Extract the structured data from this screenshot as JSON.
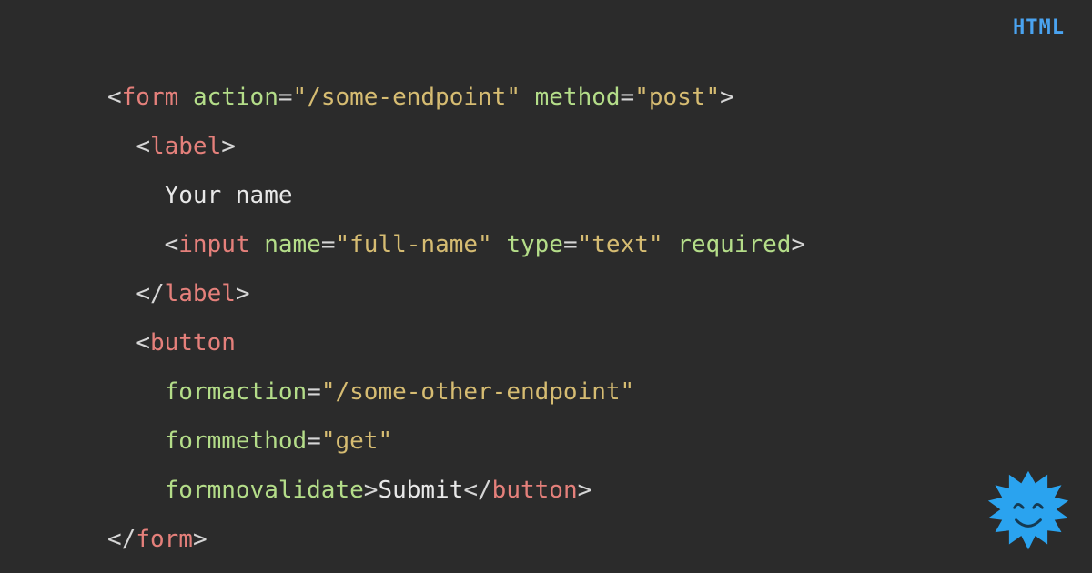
{
  "language_badge": "HTML",
  "code": {
    "l1": {
      "tag": "form",
      "attr1": "action",
      "val1": "\"/some-endpoint\"",
      "attr2": "method",
      "val2": "\"post\""
    },
    "l2": {
      "tag": "label"
    },
    "l3": {
      "text": "Your name"
    },
    "l4": {
      "tag": "input",
      "attr1": "name",
      "val1": "\"full-name\"",
      "attr2": "type",
      "val2": "\"text\"",
      "attr3": "required"
    },
    "l5": {
      "tag": "label"
    },
    "l6": {
      "tag": "button"
    },
    "l7": {
      "attr": "formaction",
      "val": "\"/some-other-endpoint\""
    },
    "l8": {
      "attr": "formmethod",
      "val": "\"get\""
    },
    "l9": {
      "attr": "formnovalidate",
      "text": "Submit",
      "closetag": "button"
    },
    "l10": {
      "tag": "form"
    }
  }
}
